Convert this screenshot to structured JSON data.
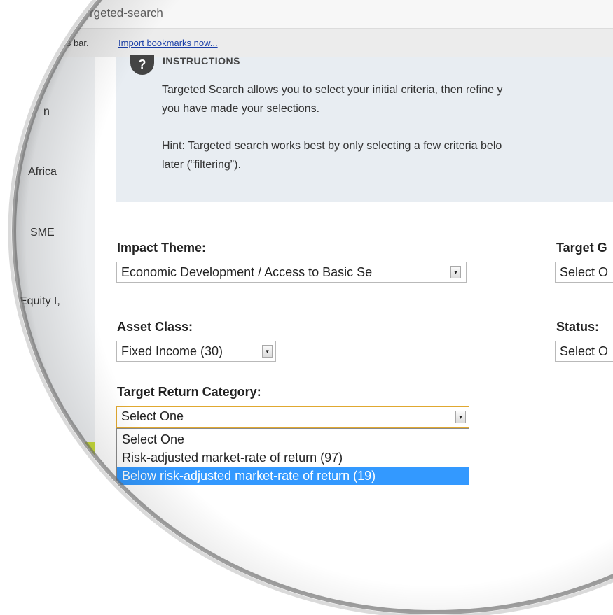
{
  "browser": {
    "url_fragment": "rgeted-search",
    "bookmarks_text": "rks bar.",
    "bookmarks_link": "Import bookmarks now..."
  },
  "sidebar": {
    "items": [
      {
        "label": "n"
      },
      {
        "label": "Africa"
      },
      {
        "label": "SME"
      },
      {
        "label": "Equity I,"
      }
    ]
  },
  "instructions": {
    "icon": "?",
    "title": "INSTRUCTIONS",
    "line1": "Targeted Search allows you to select your initial criteria, then refine y",
    "line2": "you have made your selections.",
    "line3": "Hint: Targeted search works best by only selecting a few criteria belo",
    "line4": "later (“filtering”)."
  },
  "form": {
    "impact_theme": {
      "label": "Impact Theme:",
      "value": "Economic Development / Access to Basic Se"
    },
    "target_geo": {
      "label": "Target G",
      "value": "Select O"
    },
    "asset_class": {
      "label": "Asset Class:",
      "value": "Fixed Income (30)"
    },
    "status": {
      "label": "Status:",
      "value": "Select O"
    },
    "target_return": {
      "label": "Target Return Category:",
      "value": "Select One",
      "options": [
        {
          "label": "Select One"
        },
        {
          "label": "Risk-adjusted market-rate of return (97)"
        },
        {
          "label": "Below risk-adjusted market-rate of return (19)"
        }
      ],
      "highlighted_index": 2
    }
  },
  "icons": {
    "dropdown_arrow": "▾"
  },
  "colors": {
    "highlight": "#3399ff",
    "focus_border": "#e0a830",
    "sidebar_accent": "#c8dc3c"
  }
}
